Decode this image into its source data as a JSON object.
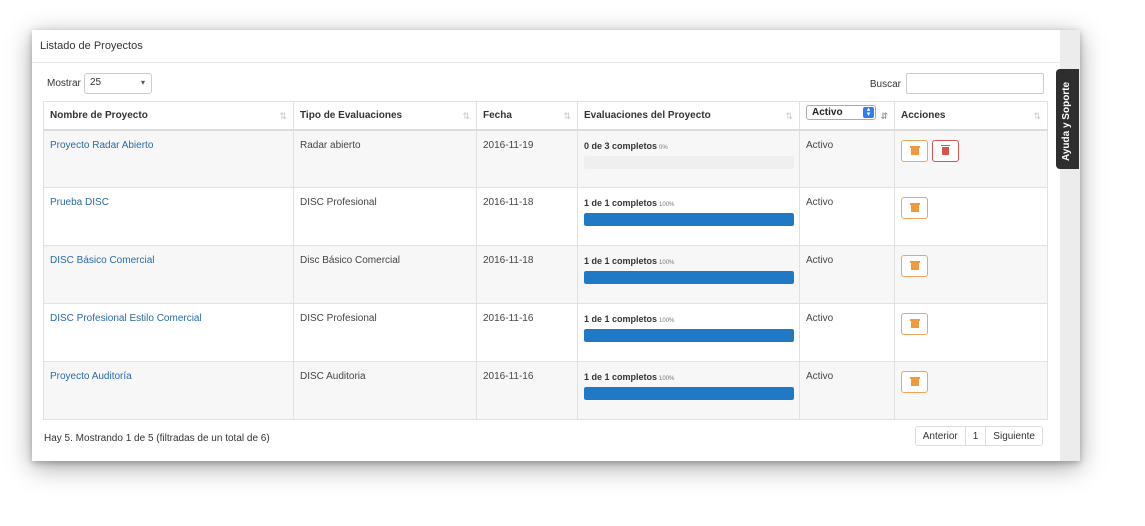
{
  "panel": {
    "title": "Listado de Proyectos"
  },
  "controls": {
    "show_label": "Mostrar",
    "show_value": "25",
    "search_label": "Buscar",
    "search_value": ""
  },
  "table": {
    "headers": {
      "name": "Nombre de Proyecto",
      "type": "Tipo de Evaluaciones",
      "date": "Fecha",
      "evaluations": "Evaluaciones del Proyecto",
      "status_filter": "Activo",
      "actions": "Acciones"
    },
    "rows": [
      {
        "name": "Proyecto Radar Abierto",
        "type": "Radar abierto",
        "date": "2016-11-19",
        "progress_label": "0 de 3 completos",
        "progress_pct": "0%",
        "progress_value": 0,
        "status": "Activo",
        "has_delete": true
      },
      {
        "name": "Prueba DISC",
        "type": "DISC Profesional",
        "date": "2016-11-18",
        "progress_label": "1 de 1 completos",
        "progress_pct": "100%",
        "progress_value": 100,
        "status": "Activo",
        "has_delete": false
      },
      {
        "name": "DISC Básico Comercial",
        "type": "Disc Básico Comercial",
        "date": "2016-11-18",
        "progress_label": "1 de 1 completos",
        "progress_pct": "100%",
        "progress_value": 100,
        "status": "Activo",
        "has_delete": false
      },
      {
        "name": "DISC Profesional Estilo Comercial",
        "type": "DISC Profesional",
        "date": "2016-11-16",
        "progress_label": "1 de 1 completos",
        "progress_pct": "100%",
        "progress_value": 100,
        "status": "Activo",
        "has_delete": false
      },
      {
        "name": "Proyecto Auditoría",
        "type": "DISC Auditoria",
        "date": "2016-11-16",
        "progress_label": "1 de 1 completos",
        "progress_pct": "100%",
        "progress_value": 100,
        "status": "Activo",
        "has_delete": false
      }
    ]
  },
  "footer": {
    "info": "Hay 5. Mostrando 1 de 5 (filtradas de un total de 6)",
    "prev": "Anterior",
    "page": "1",
    "next": "Siguiente"
  },
  "help_tab": {
    "label": "Ayuda y Soporte"
  },
  "colors": {
    "link": "#2a6aa8",
    "progress": "#1f79c4",
    "action_orange": "#f09a3e",
    "delete_red": "#d9534f"
  },
  "icons": {
    "sort": "sort-icon",
    "caret": "caret-down-icon",
    "stepper": "select-stepper-icon",
    "filter": "filter-sort-icon",
    "edit": "archive-icon",
    "delete": "trash-icon"
  }
}
